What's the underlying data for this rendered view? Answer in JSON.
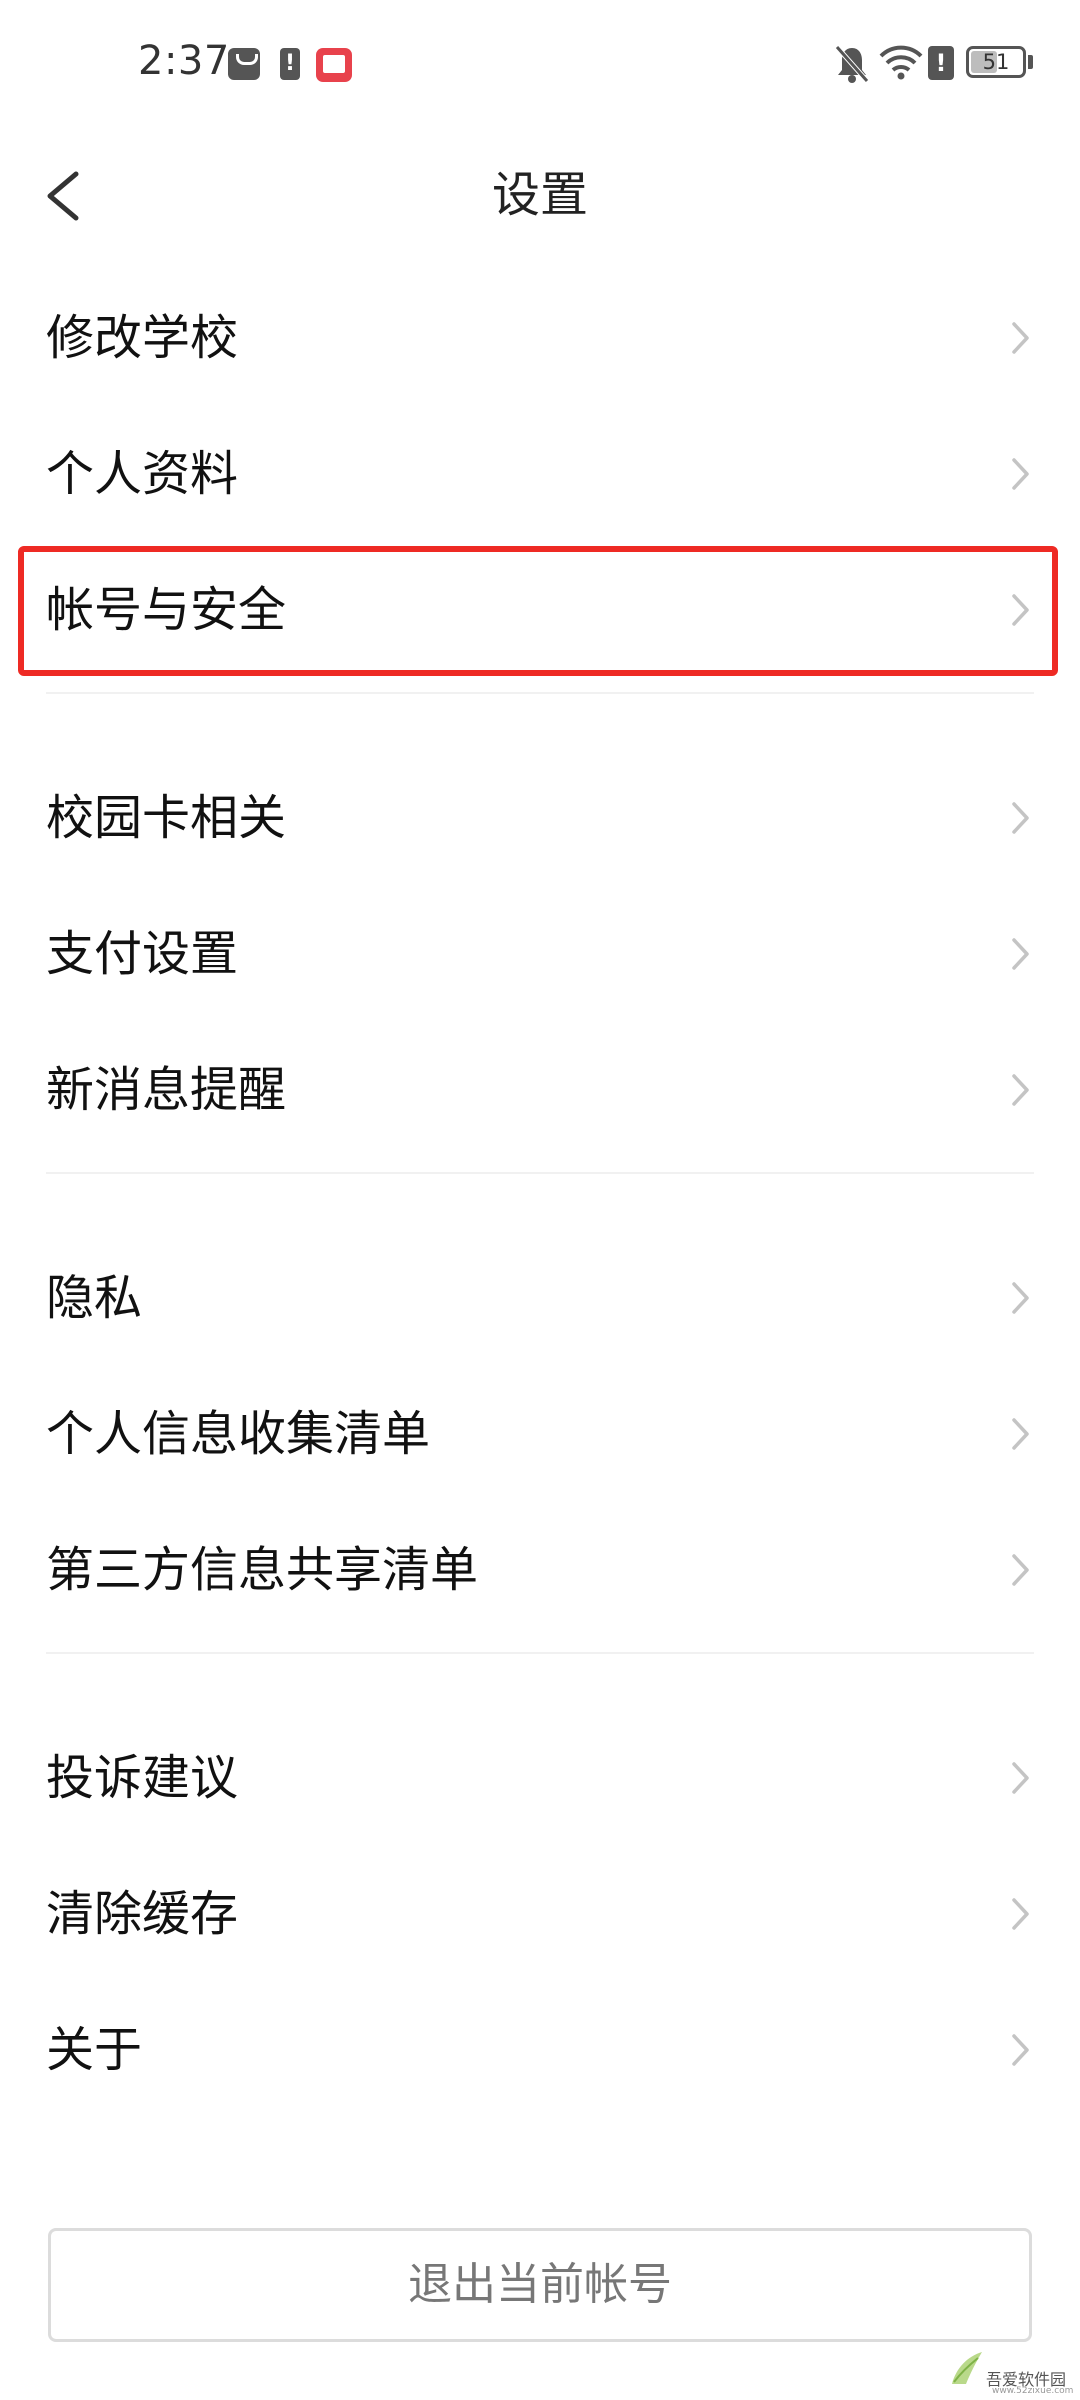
{
  "status_bar": {
    "time": "2:37",
    "battery_level": "51",
    "battery_fraction": 0.51
  },
  "header": {
    "title": "设置"
  },
  "groups": [
    {
      "items": [
        {
          "label": "修改学校"
        },
        {
          "label": "个人资料"
        },
        {
          "label": "帐号与安全",
          "highlighted": true
        }
      ]
    },
    {
      "items": [
        {
          "label": "校园卡相关"
        },
        {
          "label": "支付设置"
        },
        {
          "label": "新消息提醒"
        }
      ]
    },
    {
      "items": [
        {
          "label": "隐私"
        },
        {
          "label": "个人信息收集清单"
        },
        {
          "label": "第三方信息共享清单"
        }
      ]
    },
    {
      "items": [
        {
          "label": "投诉建议"
        },
        {
          "label": "清除缓存"
        },
        {
          "label": "关于"
        }
      ]
    }
  ],
  "logout_label": "退出当前帐号",
  "watermark": {
    "text": "吾爱软件园",
    "url": "www.52zixue.com"
  },
  "colors": {
    "highlight": "#ee2a24",
    "divider": "#f1f1f1",
    "chevron": "#c4c4c4"
  },
  "icons": {
    "back": "chevron-left-icon",
    "row": "chevron-right-icon"
  }
}
